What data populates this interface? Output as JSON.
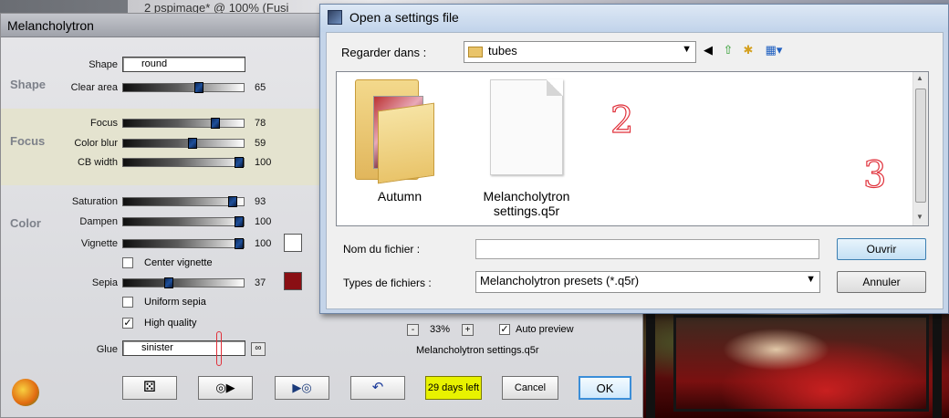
{
  "background": {
    "title_fragment": "2 pspimage* @ 100% (Fusi"
  },
  "plugin": {
    "title": "Melancholytron",
    "sections": {
      "shape": "Shape",
      "focus": "Focus",
      "color": "Color"
    },
    "shape": {
      "label": "Shape",
      "value": "round"
    },
    "clear_area": {
      "label": "Clear area",
      "value": 65
    },
    "focus": {
      "label": "Focus",
      "value": 78
    },
    "color_blur": {
      "label": "Color blur",
      "value": 59
    },
    "cb_width": {
      "label": "CB width",
      "value": 100
    },
    "saturation": {
      "label": "Saturation",
      "value": 93
    },
    "dampen": {
      "label": "Dampen",
      "value": 100
    },
    "vignette": {
      "label": "Vignette",
      "value": 100,
      "swatch": "#ffffff"
    },
    "center_vignette": {
      "label": "Center vignette",
      "checked": false
    },
    "sepia": {
      "label": "Sepia",
      "value": 37,
      "swatch": "#8a0f14"
    },
    "uniform_sepia": {
      "label": "Uniform sepia",
      "checked": false
    },
    "high_quality": {
      "label": "High quality",
      "checked": true
    },
    "glue": {
      "label": "Glue",
      "value": "sinister"
    },
    "zoom": {
      "minus": "-",
      "value": "33%",
      "plus": "+"
    },
    "auto_preview": {
      "label": "Auto preview",
      "checked": true
    },
    "settings_file": "Melancholytron settings.q5r",
    "buttons": {
      "days_left": "29 days left",
      "cancel": "Cancel",
      "ok": "OK"
    },
    "icons": [
      "dice-icon",
      "play-disc-icon",
      "disc-play-icon",
      "undo-icon",
      "plugin-logo-icon",
      "link-icon"
    ]
  },
  "dialog": {
    "title": "Open a settings file",
    "look_in_label": "Regarder dans :",
    "look_in_value": "tubes",
    "files": [
      {
        "name": "Autumn",
        "type": "folder"
      },
      {
        "name": "Melancholytron settings.q5r",
        "type": "file"
      }
    ],
    "markers": [
      "2",
      "3"
    ],
    "filename_label": "Nom du fichier :",
    "filename_value": "",
    "filetypes_label": "Types de fichiers :",
    "filetypes_value": "Melancholytron presets (*.q5r)",
    "open_button": "Ouvrir",
    "cancel_button": "Annuler"
  }
}
